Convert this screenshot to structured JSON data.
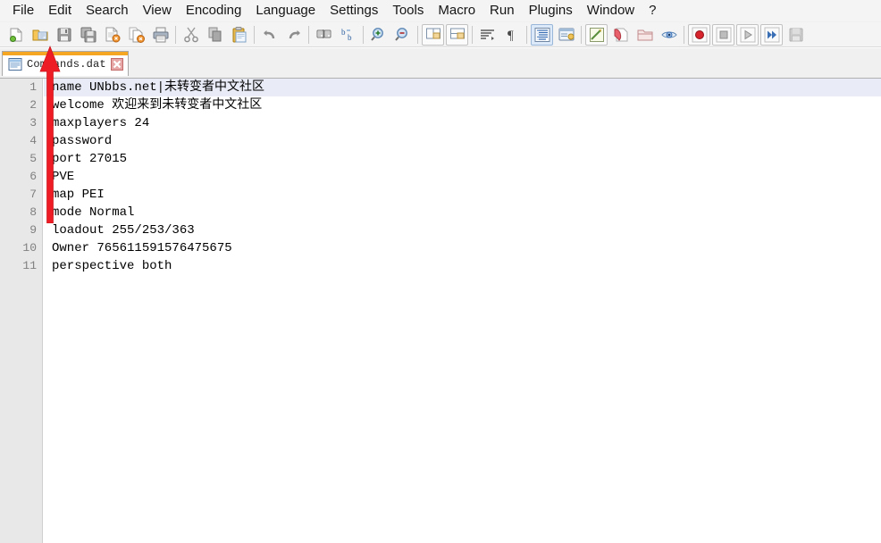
{
  "app": {
    "name": "Notepad++",
    "accent_orange": "#f5a623",
    "annotation_red": "#ee1c25",
    "gutter_bg": "#e8e8e8",
    "current_line_bg": "#e9ecf6"
  },
  "menubar": {
    "items": [
      {
        "label": "File",
        "name": "menu-file"
      },
      {
        "label": "Edit",
        "name": "menu-edit"
      },
      {
        "label": "Search",
        "name": "menu-search"
      },
      {
        "label": "View",
        "name": "menu-view"
      },
      {
        "label": "Encoding",
        "name": "menu-encoding"
      },
      {
        "label": "Language",
        "name": "menu-language"
      },
      {
        "label": "Settings",
        "name": "menu-settings"
      },
      {
        "label": "Tools",
        "name": "menu-tools"
      },
      {
        "label": "Macro",
        "name": "menu-macro"
      },
      {
        "label": "Run",
        "name": "menu-run"
      },
      {
        "label": "Plugins",
        "name": "menu-plugins"
      },
      {
        "label": "Window",
        "name": "menu-window"
      },
      {
        "label": "?",
        "name": "menu-help"
      }
    ]
  },
  "toolbar": {
    "buttons": [
      {
        "icon": "new-file-icon",
        "label": "New"
      },
      {
        "icon": "open-file-icon",
        "label": "Open"
      },
      {
        "icon": "save-icon",
        "label": "Save"
      },
      {
        "icon": "save-all-icon",
        "label": "Save All"
      },
      {
        "icon": "close-file-icon",
        "label": "Close"
      },
      {
        "icon": "close-all-icon",
        "label": "Close All"
      },
      {
        "icon": "print-icon",
        "label": "Print"
      },
      {
        "icon": "cut-icon",
        "label": "Cut"
      },
      {
        "icon": "copy-icon",
        "label": "Copy"
      },
      {
        "icon": "paste-icon",
        "label": "Paste"
      },
      {
        "icon": "undo-icon",
        "label": "Undo"
      },
      {
        "icon": "redo-icon",
        "label": "Redo"
      },
      {
        "icon": "find-icon",
        "label": "Find"
      },
      {
        "icon": "replace-icon",
        "label": "Replace"
      },
      {
        "icon": "zoom-in-icon",
        "label": "Zoom In"
      },
      {
        "icon": "zoom-out-icon",
        "label": "Zoom Out"
      },
      {
        "icon": "sync-vertical-icon",
        "label": "Synchronize Vertical Scrolling"
      },
      {
        "icon": "sync-horizontal-icon",
        "label": "Synchronize Horizontal Scrolling"
      },
      {
        "icon": "word-wrap-icon",
        "label": "Word Wrap"
      },
      {
        "icon": "show-all-chars-icon",
        "label": "Show All Characters"
      },
      {
        "icon": "indent-guide-icon",
        "label": "Show Indent Guide"
      },
      {
        "icon": "user-define-dialog-icon",
        "label": "User Defined Dialogue"
      },
      {
        "icon": "function-list-icon",
        "label": "Function List"
      },
      {
        "icon": "document-map-icon",
        "label": "Document Map"
      },
      {
        "icon": "folder-workspace-icon",
        "label": "Folder as Workspace"
      },
      {
        "icon": "monitoring-icon",
        "label": "Monitoring"
      },
      {
        "icon": "macro-record-icon",
        "label": "Start Recording"
      },
      {
        "icon": "macro-stop-icon",
        "label": "Stop Recording"
      },
      {
        "icon": "macro-play-icon",
        "label": "Playback"
      },
      {
        "icon": "macro-run-multiple-icon",
        "label": "Run a Macro Multiple Times"
      },
      {
        "icon": "macro-save-icon",
        "label": "Save Currently Recorded Macro"
      }
    ]
  },
  "tabs": [
    {
      "label": "Commands.dat",
      "name": "tab-commands-dat",
      "icon": "document-icon",
      "close_icon": "close-icon",
      "active": true
    }
  ],
  "editor": {
    "current_line": 1,
    "lines": [
      {
        "number": "1",
        "text": "name UNbbs.net|未转变者中文社区"
      },
      {
        "number": "2",
        "text": "welcome 欢迎来到未转变者中文社区"
      },
      {
        "number": "3",
        "text": "maxplayers 24"
      },
      {
        "number": "4",
        "text": "password"
      },
      {
        "number": "5",
        "text": "port 27015"
      },
      {
        "number": "6",
        "text": "PVE"
      },
      {
        "number": "7",
        "text": "map PEI"
      },
      {
        "number": "8",
        "text": "mode Normal"
      },
      {
        "number": "9",
        "text": "loadout 255/253/363"
      },
      {
        "number": "10",
        "text": "Owner 765611591576475675"
      },
      {
        "number": "11",
        "text": "perspective both"
      }
    ]
  },
  "annotation": {
    "arrow": {
      "name": "red-arrow-annotation",
      "direction": "up",
      "color": "#ee1c25"
    }
  }
}
